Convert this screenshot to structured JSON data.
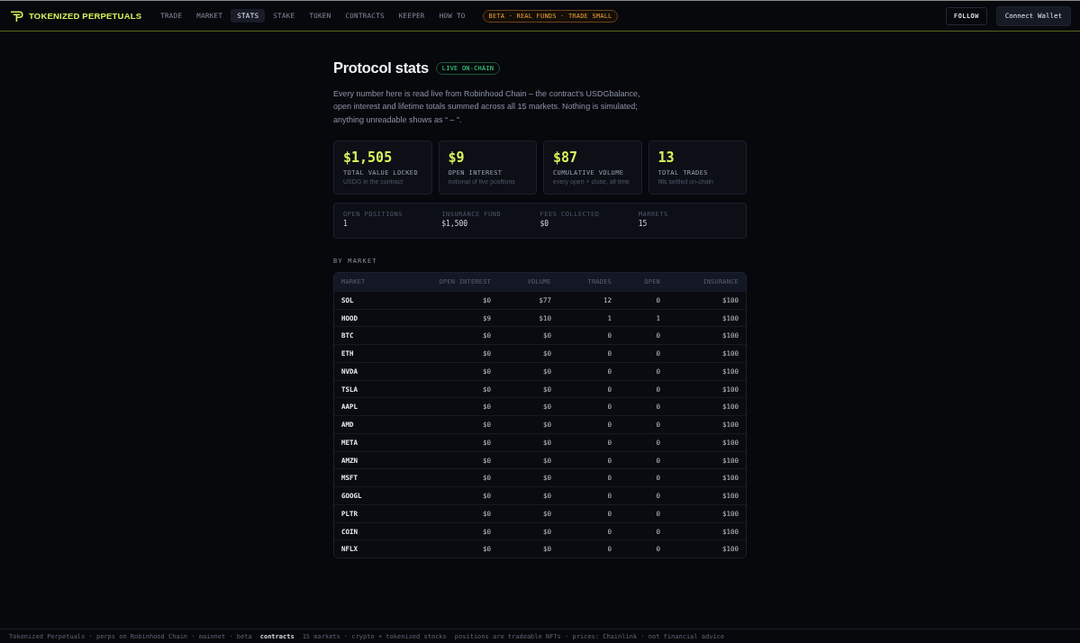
{
  "header": {
    "brand": "TOKENIZED PERPETUALS",
    "nav": [
      {
        "label": "TRADE",
        "selected": false
      },
      {
        "label": "MARKET",
        "selected": false
      },
      {
        "label": "STATS",
        "selected": true
      },
      {
        "label": "STAKE",
        "selected": false
      },
      {
        "label": "TOKEN",
        "selected": false
      },
      {
        "label": "CONTRACTS",
        "selected": false
      },
      {
        "label": "KEEPER",
        "selected": false
      },
      {
        "label": "HOW TO",
        "selected": false
      }
    ],
    "beta_badge": "BETA · REAL FUNDS · TRADE SMALL",
    "buttons": [
      {
        "label": "FOLLOW",
        "kind": "outline"
      },
      {
        "label": "Connect Wallet",
        "kind": "filled"
      }
    ]
  },
  "page": {
    "title": "Protocol stats",
    "badge": "LIVE ON-CHAIN",
    "description": "Every number here is read live from Robinhood Chain – the contract’s USDGbalance, open interest and lifetime totals summed across all 15 markets. Nothing is simulated; anything unreadable shows as “ – ”.",
    "stat_cards": [
      {
        "value": "$1,505",
        "label": "TOTAL VALUE LOCKED",
        "note": "USDG in the contract"
      },
      {
        "value": "$9",
        "label": "OPEN INTEREST",
        "note": "notional of live positions"
      },
      {
        "value": "$87",
        "label": "CUMULATIVE VOLUME",
        "note": "every open + close, all time"
      },
      {
        "value": "13",
        "label": "TOTAL TRADES",
        "note": "fills settled on-chain"
      }
    ],
    "summary": [
      {
        "label": "OPEN POSITIONS",
        "value": "1"
      },
      {
        "label": "INSURANCE FUND",
        "value": "$1,500"
      },
      {
        "label": "FEES COLLECTED",
        "value": "$0"
      },
      {
        "label": "MARKETS",
        "value": "15"
      }
    ],
    "section_title": "BY MARKET",
    "table": {
      "columns": [
        "MARKET",
        "OPEN INTEREST",
        "VOLUME",
        "TRADES",
        "OPEN",
        "INSURANCE"
      ],
      "rows": [
        [
          "SOL",
          "$0",
          "$77",
          "12",
          "0",
          "$100"
        ],
        [
          "HOOD",
          "$9",
          "$10",
          "1",
          "1",
          "$100"
        ],
        [
          "BTC",
          "$0",
          "$0",
          "0",
          "0",
          "$100"
        ],
        [
          "ETH",
          "$0",
          "$0",
          "0",
          "0",
          "$100"
        ],
        [
          "NVDA",
          "$0",
          "$0",
          "0",
          "0",
          "$100"
        ],
        [
          "TSLA",
          "$0",
          "$0",
          "0",
          "0",
          "$100"
        ],
        [
          "AAPL",
          "$0",
          "$0",
          "0",
          "0",
          "$100"
        ],
        [
          "AMD",
          "$0",
          "$0",
          "0",
          "0",
          "$100"
        ],
        [
          "META",
          "$0",
          "$0",
          "0",
          "0",
          "$100"
        ],
        [
          "AMZN",
          "$0",
          "$0",
          "0",
          "0",
          "$100"
        ],
        [
          "MSFT",
          "$0",
          "$0",
          "0",
          "0",
          "$100"
        ],
        [
          "GOOGL",
          "$0",
          "$0",
          "0",
          "0",
          "$100"
        ],
        [
          "PLTR",
          "$0",
          "$0",
          "0",
          "0",
          "$100"
        ],
        [
          "COIN",
          "$0",
          "$0",
          "0",
          "0",
          "$100"
        ],
        [
          "NFLX",
          "$0",
          "$0",
          "0",
          "0",
          "$100"
        ]
      ]
    }
  },
  "footer": [
    {
      "kind": "text",
      "text": "Tokenized Perpetuals · perps on Robinhood Chain · mainnet · beta"
    },
    {
      "kind": "link",
      "text": "contracts"
    },
    {
      "kind": "text",
      "text": "15 markets · crypto + tokenized stocks"
    },
    {
      "kind": "text",
      "text": "positions are tradeable NFTs · prices: Chainlink · not financial advice"
    }
  ]
}
